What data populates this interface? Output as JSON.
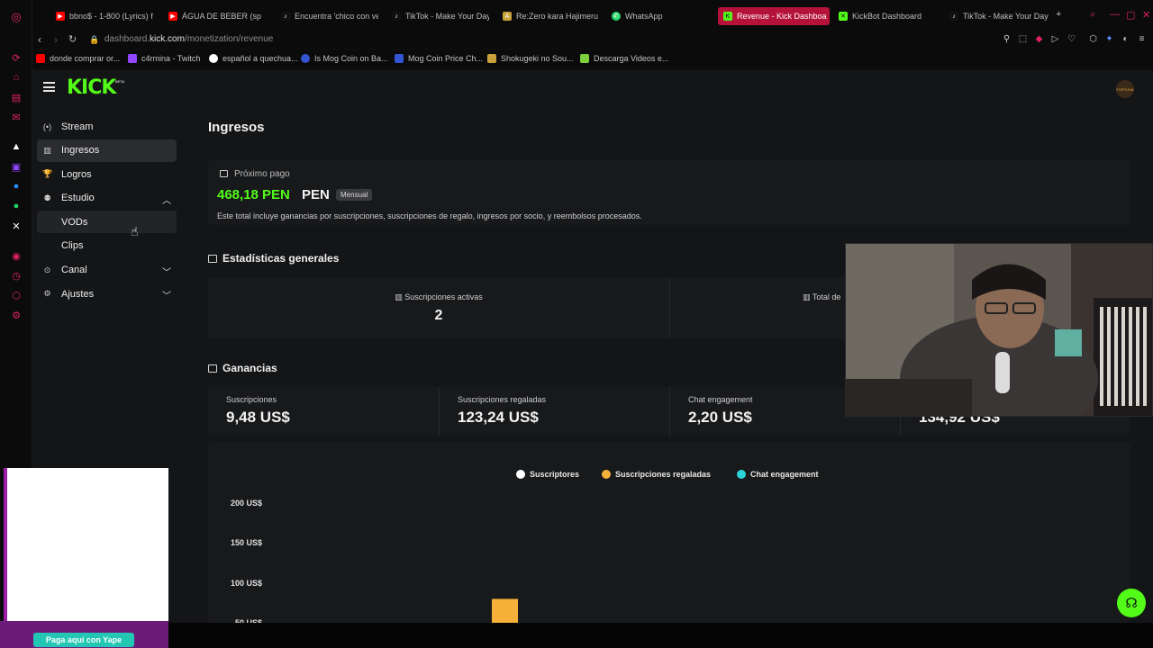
{
  "colors": {
    "kick_green": "#53fc18",
    "tab_active": "#b5123a",
    "sidebar_active": "#2b2c2f",
    "legend_subs": "#ffffff",
    "legend_gifted": "#f5b03a",
    "legend_chat": "#2ad4d8"
  },
  "tabs": [
    {
      "label": "bbno$ - 1-800 (Lyrics) ft",
      "icon": "youtube-icon",
      "active": false
    },
    {
      "label": "ÁGUA DE BEBER (sp",
      "icon": "youtube-icon",
      "active": false
    },
    {
      "label": "Encuentra 'chico con ve",
      "icon": "tiktok-icon",
      "active": false
    },
    {
      "label": "TikTok - Make Your Day",
      "icon": "tiktok-icon",
      "active": false
    },
    {
      "label": "Re:Zero kara Hajimeru I",
      "icon": "anime-icon",
      "active": false
    },
    {
      "label": "WhatsApp",
      "icon": "whatsapp-icon",
      "active": false
    },
    {
      "label": "Revenue - Kick Dashboa",
      "icon": "kick-icon",
      "active": true
    },
    {
      "label": "KickBot Dashboard",
      "icon": "kickbot-icon",
      "active": false
    },
    {
      "label": "TikTok - Make Your Day",
      "icon": "tiktok-icon",
      "active": false
    }
  ],
  "address": {
    "prefix": "dashboard.",
    "domain": "kick.com",
    "path": "/monetization/revenue"
  },
  "bookmarks": [
    {
      "label": "donde comprar or..."
    },
    {
      "label": "c4rmina - Twitch"
    },
    {
      "label": "español a quechua..."
    },
    {
      "label": "Is Mog Coin on Ba..."
    },
    {
      "label": "Mog Coin Price Ch..."
    },
    {
      "label": "Shokugeki no Sou..."
    },
    {
      "label": "Descarga Videos e..."
    }
  ],
  "header": {
    "logo": "KICK",
    "logo_badge": "BETA",
    "avatar_text": "FORTUNA"
  },
  "sidebar": {
    "items": [
      {
        "label": "Stream",
        "icon": "broadcast-icon"
      },
      {
        "label": "Ingresos",
        "icon": "chart-icon"
      },
      {
        "label": "Logros",
        "icon": "trophy-icon"
      },
      {
        "label": "Estudio",
        "icon": "studio-icon"
      },
      {
        "label": "VODs"
      },
      {
        "label": "Clips"
      },
      {
        "label": "Canal",
        "icon": "channel-icon"
      },
      {
        "label": "Ajustes",
        "icon": "gear-icon"
      }
    ]
  },
  "main": {
    "title": "Ingresos",
    "payout": {
      "label": "Próximo pago",
      "amount": "468,18 PEN",
      "currency": "PEN",
      "badge": "Mensual",
      "note": "Este total incluye ganancias por suscripciones, suscripciones de regalo, ingresos por socio, y reembolsos procesados."
    },
    "stats": {
      "title": "Estadísticas generales",
      "cells": [
        {
          "label": "Suscripciones activas",
          "value": "2"
        },
        {
          "label": "Total de",
          "value": ""
        }
      ]
    },
    "earnings": {
      "title": "Ganancias",
      "cells": [
        {
          "label": "Suscripciones",
          "value": "9,48 US$"
        },
        {
          "label": "Suscripciones regaladas",
          "value": "123,24 US$"
        },
        {
          "label": "Chat engagement",
          "value": "2,20 US$"
        },
        {
          "label": "",
          "value": "134,92 US$"
        }
      ]
    }
  },
  "chart_data": {
    "type": "bar",
    "series": [
      {
        "name": "Suscriptores",
        "values": []
      },
      {
        "name": "Suscripciones regaladas",
        "values": [
          105
        ]
      },
      {
        "name": "Chat engagement",
        "values": []
      }
    ],
    "yticks": [
      "200 US$",
      "150 US$",
      "100 US$",
      "50 US$"
    ],
    "ylim": [
      0,
      200
    ]
  },
  "footer": {
    "yape": "Paga aquí con Yape"
  }
}
